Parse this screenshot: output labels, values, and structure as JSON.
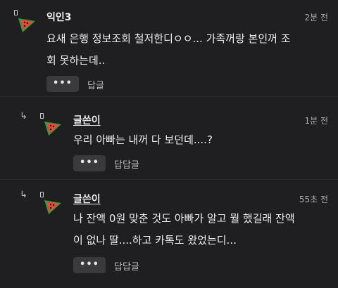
{
  "comments": [
    {
      "author": "익인3",
      "time": "2분 전",
      "lines": [
        "요새 은행 정보조회 철저한디ㅇㅇ... 가족꺼랑 본인꺼 조",
        "회 못하는데.."
      ],
      "more_label": "•••",
      "reply_label": "답글"
    },
    {
      "author": "글쓴이",
      "time": "1분 전",
      "lines": [
        "우리 아빠는 내꺼 다 보던데....?"
      ],
      "more_label": "•••",
      "reply_label": "답답글"
    },
    {
      "author": "글쓴이",
      "time": "55초 전",
      "lines": [
        "나 잔액 0원 맞춘 것도 아빠가 알고 뭘 했길래 잔액",
        "이 없나 딸....하고 카톡도 왔었는디..."
      ],
      "more_label": "•••",
      "reply_label": "답답글"
    }
  ],
  "icons": {
    "avatar": "watermelon-icon",
    "reply_indicator": "reply-arrow-icon"
  },
  "colors": {
    "background": "#1f1f21",
    "button": "#3a3a3d",
    "watermelon_rind": "#2e9d3a",
    "watermelon_flesh": "#e8473c"
  }
}
